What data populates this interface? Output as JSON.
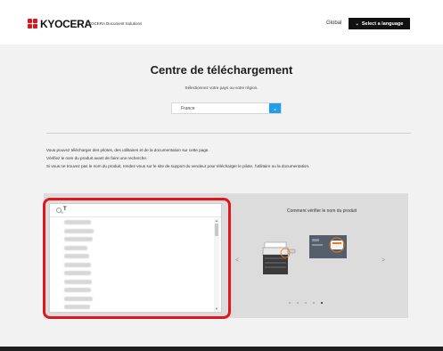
{
  "header": {
    "brand": "KYOCERA",
    "brand_sub": "KYOCERA Document Solutions",
    "global_link": "Global",
    "language_button": "Select a language",
    "language_chevron": "⌄"
  },
  "main": {
    "title": "Centre de téléchargement",
    "subtitle": "Sélectionnez votre pays ou votre région.",
    "country_select": {
      "value": "France",
      "caret": "⌄"
    },
    "info_lines": [
      "Vous pouvez télécharger des pilotes, des utilitaires et de la documentation sur cette page.",
      "Vérifiez le nom du produit avant de faire une recherche.",
      "Si vous ne trouvez pas le nom du produit, rendez-vous sur le site de support du vendeur pour télécharger le pilote, l'utilitaire ou la documentation."
    ]
  },
  "product_search": {
    "query": "T",
    "results_count_blurred": 11,
    "scroll_up": "▲",
    "scroll_down": "▼"
  },
  "howto": {
    "title": "Comment vérifier le nom du produit",
    "prev": "<",
    "next": ">",
    "slides_total": 5,
    "active_slide": 5
  },
  "colors": {
    "brand_red": "#d7191f",
    "accent_blue": "#1e9fe6",
    "highlight_red": "#e0181e",
    "button_black": "#111111"
  }
}
